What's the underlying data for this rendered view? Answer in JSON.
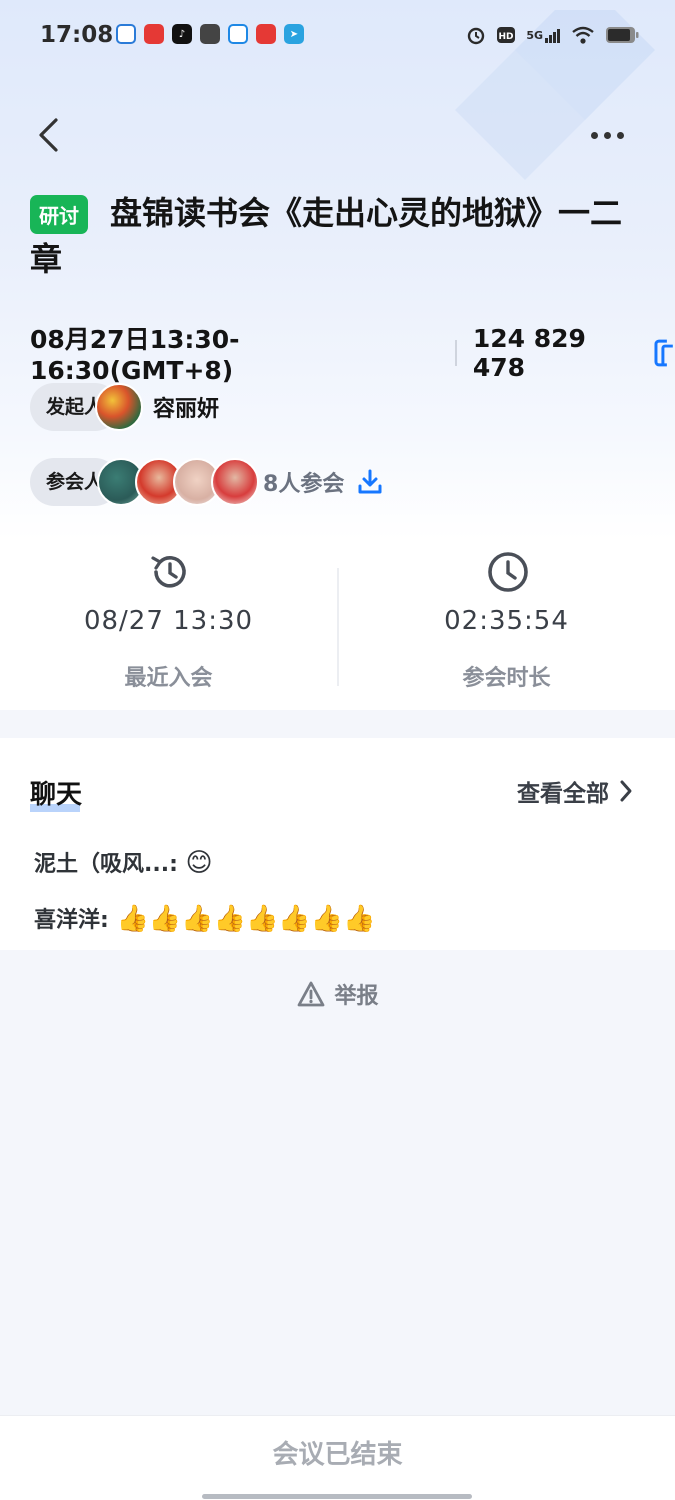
{
  "status_bar": {
    "time": "17:08",
    "network": "5G"
  },
  "header": {
    "back_icon": "chevron-left-icon",
    "more_icon": "more-dots-icon"
  },
  "meeting": {
    "tag": "研讨",
    "title": "盘锦读书会《走出心灵的地狱》一二章",
    "time_range": "08月27日13:30-16:30(GMT+8)",
    "meeting_id": "124 829 478",
    "host_label": "发起人",
    "host_name": "容丽妍",
    "attendee_label": "参会人",
    "attendee_count": "8人参会"
  },
  "stats": {
    "recent_join": {
      "value": "08/27 13:30",
      "label": "最近入会"
    },
    "duration": {
      "value": "02:35:54",
      "label": "参会时长"
    }
  },
  "chat": {
    "title": "聊天",
    "view_all": "查看全部",
    "messages": [
      {
        "sender": "泥土（吸风...:",
        "content": "😊"
      },
      {
        "sender": "喜洋洋:",
        "content": "👍👍👍👍👍👍👍👍"
      }
    ]
  },
  "report": {
    "label": "举报"
  },
  "footer": {
    "button": "会议已结束"
  },
  "colors": {
    "accent": "#1677ff",
    "tag_green": "#18b557"
  }
}
